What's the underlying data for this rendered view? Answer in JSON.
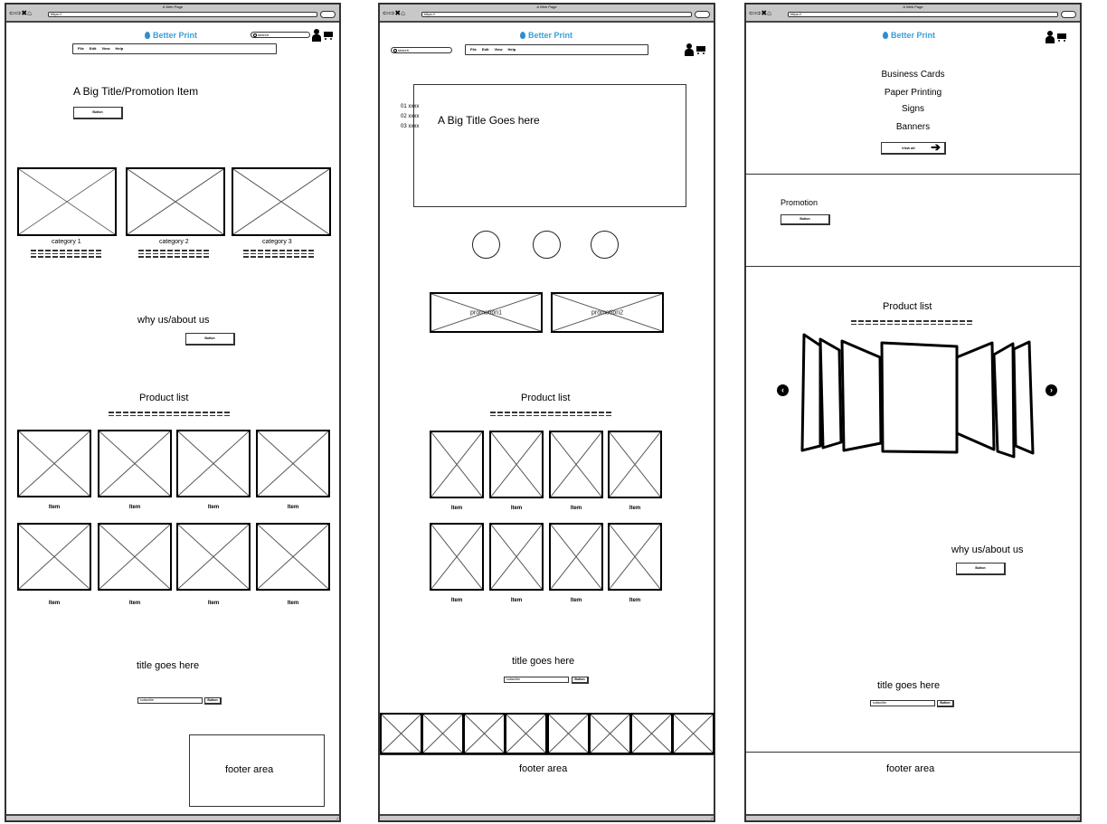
{
  "browser": {
    "window_title": "A Web Page",
    "url": "https://",
    "nav_glyphs": "⇦⇨✖⌂"
  },
  "brand": {
    "name": "Better Print",
    "accent_color": "#3a9fd8"
  },
  "menu": [
    "File",
    "Edit",
    "View",
    "Help"
  ],
  "search": {
    "placeholder": "search"
  },
  "common": {
    "button_label": "Button",
    "subscribe_placeholder": "subscribe",
    "item_label": "Item",
    "footer": "footer area",
    "subscribe_title": "title goes here",
    "product_list_title": "Product list",
    "why_us_title": "why us/about us"
  },
  "wireframe_1": {
    "hero_title": "A Big Title/Promotion Item",
    "categories": [
      "category 1",
      "category 2",
      "category 3"
    ],
    "items": [
      "Item",
      "Item",
      "Item",
      "Item",
      "Item",
      "Item",
      "Item",
      "Item"
    ]
  },
  "wireframe_2": {
    "hero_title": "A Big Title Goes here",
    "hero_bullets": [
      "01 xxxx",
      "02 xxxx",
      "03 xxxx"
    ],
    "promotions": [
      "promotion1",
      "promotion2"
    ],
    "items": [
      "Item",
      "Item",
      "Item",
      "Item",
      "Item",
      "Item",
      "Item",
      "Item"
    ],
    "strip_tiles": 8
  },
  "wireframe_3": {
    "nav_links": [
      "Business Cards",
      "Paper Printing",
      "Signs",
      "Banners"
    ],
    "view_all_label": "View all",
    "promotion_title": "Promotion"
  }
}
